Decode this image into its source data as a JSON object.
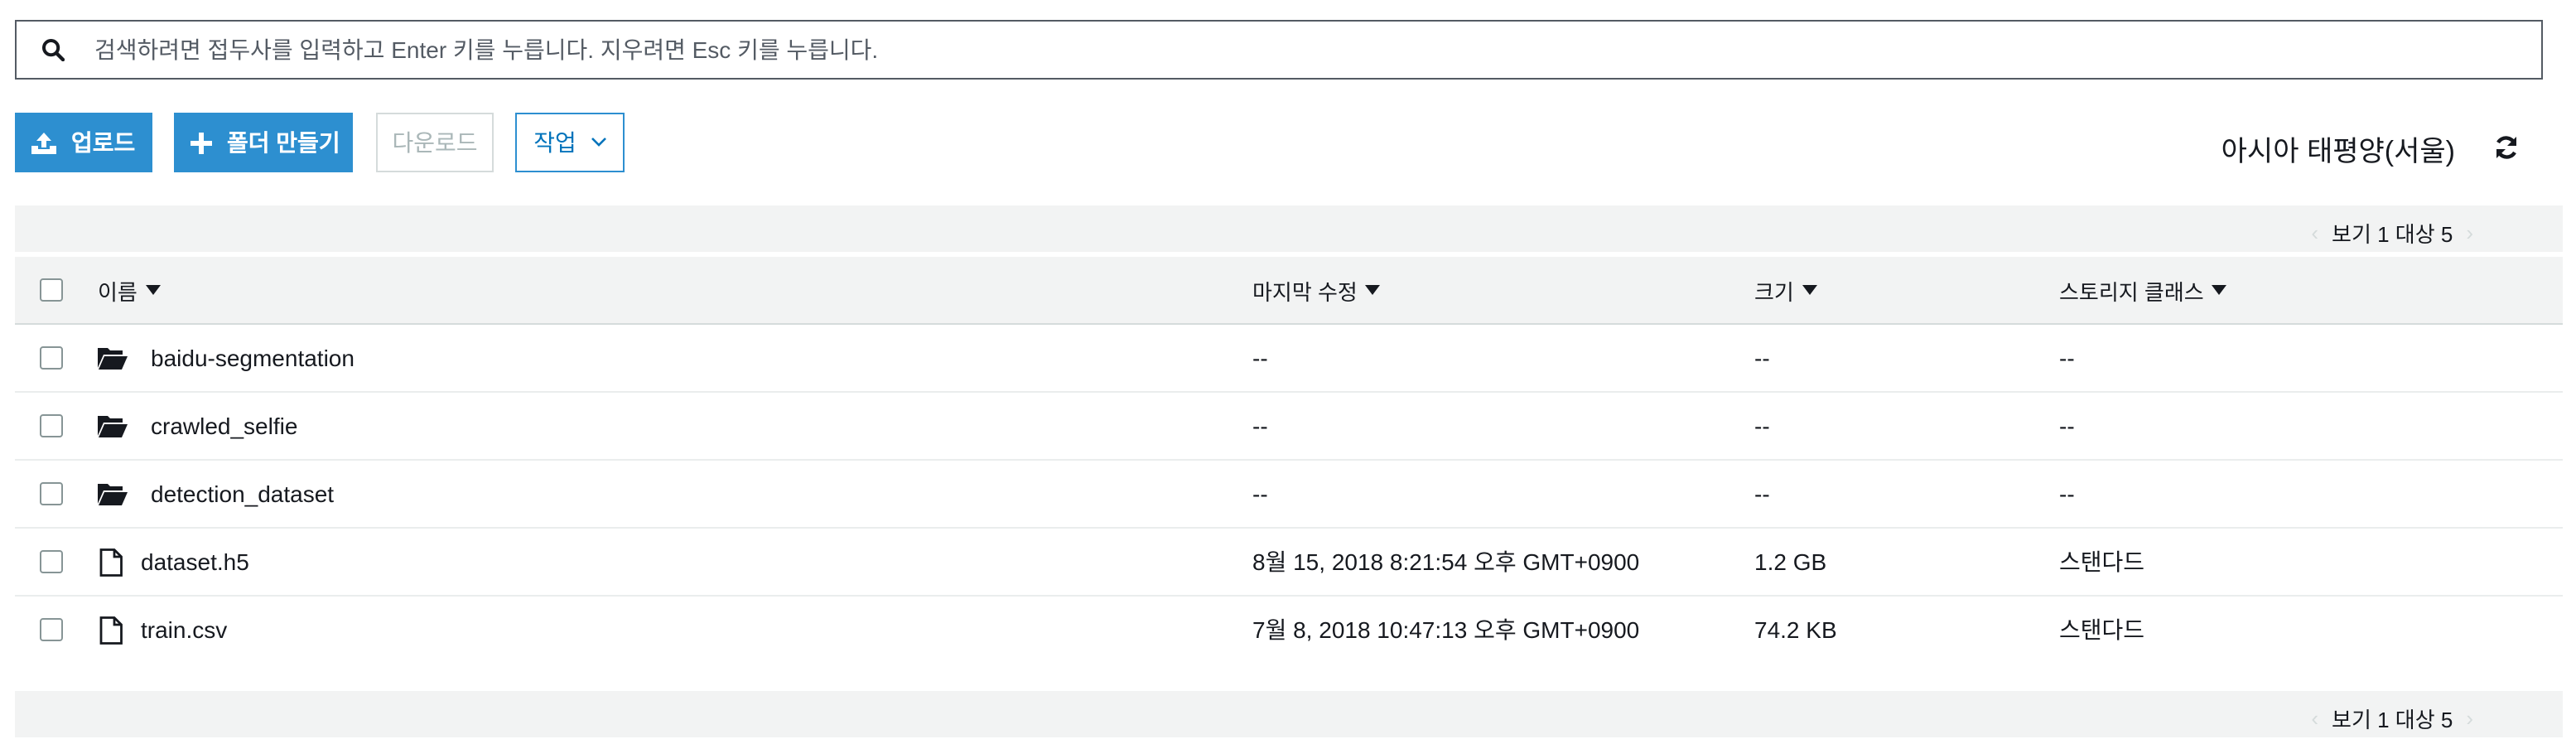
{
  "search": {
    "placeholder": "검색하려면 접두사를 입력하고 Enter 키를 누릅니다. 지우려면 Esc 키를 누릅니다."
  },
  "toolbar": {
    "upload_label": "업로드",
    "create_folder_label": "폴더 만들기",
    "download_label": "다운로드",
    "actions_label": "작업"
  },
  "region": {
    "label": "아시아 태평양(서울)"
  },
  "pager": {
    "label": "보기 1 대상 5"
  },
  "table": {
    "headers": {
      "name": "이름",
      "last_modified": "마지막 수정",
      "size": "크기",
      "storage_class": "스토리지 클래스"
    },
    "rows": [
      {
        "type": "folder",
        "name": "baidu-segmentation",
        "last_modified": "--",
        "size": "--",
        "storage_class": "--"
      },
      {
        "type": "folder",
        "name": "crawled_selfie",
        "last_modified": "--",
        "size": "--",
        "storage_class": "--"
      },
      {
        "type": "folder",
        "name": "detection_dataset",
        "last_modified": "--",
        "size": "--",
        "storage_class": "--"
      },
      {
        "type": "file",
        "name": "dataset.h5",
        "last_modified": "8월 15, 2018 8:21:54 오후 GMT+0900",
        "size": "1.2 GB",
        "storage_class": "스탠다드"
      },
      {
        "type": "file",
        "name": "train.csv",
        "last_modified": "7월 8, 2018 10:47:13 오후 GMT+0900",
        "size": "74.2 KB",
        "storage_class": "스탠다드"
      }
    ]
  },
  "colors": {
    "primary": "#2d8fd0",
    "link": "#0073bb",
    "band": "#f2f3f3",
    "border": "#d5dbdb"
  },
  "icons": {
    "search": "search-icon",
    "upload": "upload-icon",
    "plus": "plus-icon",
    "chevron": "chevron-down-icon",
    "refresh": "refresh-icon",
    "folder": "folder-icon",
    "file": "file-icon",
    "sort": "sort-caret-icon"
  }
}
